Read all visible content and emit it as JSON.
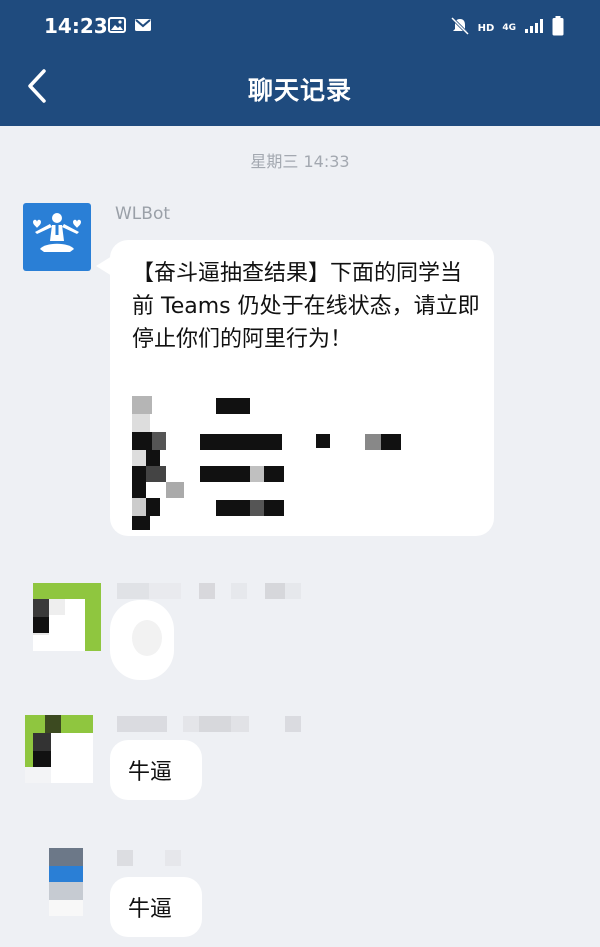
{
  "status_bar": {
    "time": "14:23",
    "hd_label": "HD",
    "network_label": "4G"
  },
  "nav": {
    "title": "聊天记录"
  },
  "chat": {
    "timestamp": "星期三 14:33",
    "messages": [
      {
        "sender": "WLBot",
        "text": "【奋斗逼抽查结果】下面的同学当前 Teams 仍处于在线状态，请立即停止你们的阿里行为！"
      },
      {
        "sender": "",
        "text": ""
      },
      {
        "sender": "",
        "text": "牛逼"
      },
      {
        "sender": "",
        "text": "牛逼"
      }
    ]
  },
  "colors": {
    "header": "#1f4b7e",
    "background": "#eef0f4",
    "bot_avatar": "#2a7fd6",
    "avatar_green": "#8fc63f"
  }
}
